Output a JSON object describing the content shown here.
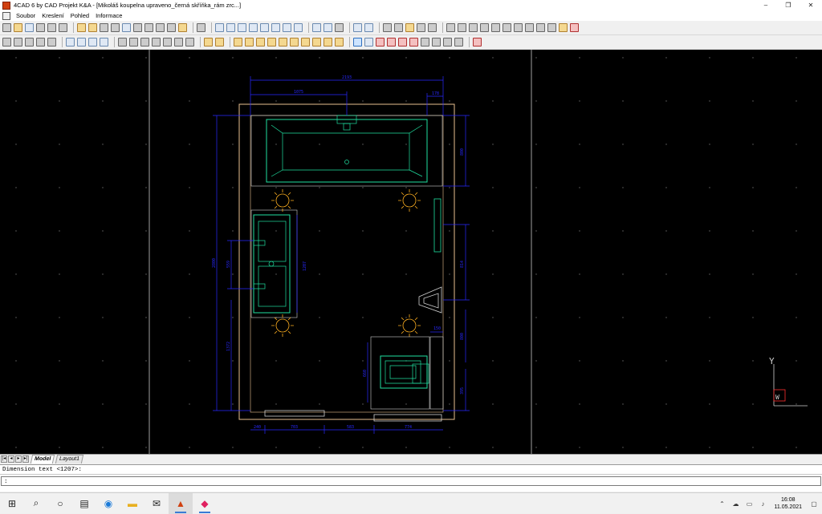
{
  "window": {
    "title": "4CAD 6 by CAD Projekt K&A - [Mikoláš koupelna upraveno_černá skříňka_rám zrc...]",
    "controls": {
      "minimize": "–",
      "maximize": "❐",
      "close": "✕"
    }
  },
  "menu": {
    "items": [
      "Soubor",
      "Kreslení",
      "Pohled",
      "Informace"
    ]
  },
  "drawing": {
    "dimensions": {
      "top_total": "2193",
      "top_left": "1075",
      "top_right": "178",
      "right_bathtub": "800",
      "right_middle": "814",
      "right_lower": "800",
      "right_bottom": "395",
      "left_total": "2800",
      "left_upper": "559",
      "left_lower": "1372",
      "cabinet": "1207",
      "wc": "660",
      "bottom_a": "240",
      "bottom_b": "703",
      "bottom_c": "583",
      "bottom_d": "774",
      "small_right": "150"
    },
    "ucs": {
      "y_label": "Y",
      "w_label": "W"
    },
    "colors": {
      "background": "#000000",
      "walls": "#e8c090",
      "dimensions": "#2828ff",
      "fixtures": "#20e0a0",
      "lights": "#ffb020"
    }
  },
  "layout_tabs": {
    "items": [
      "Model",
      "Layout1"
    ],
    "active": "Model"
  },
  "command": {
    "history_line": "Dimension text <1207>:",
    "prompt": ":"
  },
  "taskbar": {
    "icons": [
      "windows-start",
      "search",
      "task-view",
      "widgets",
      "edge",
      "file-explorer",
      "mail",
      "4cad-app",
      "paint-app"
    ],
    "time": "16:08",
    "date": "11.05.2021"
  }
}
